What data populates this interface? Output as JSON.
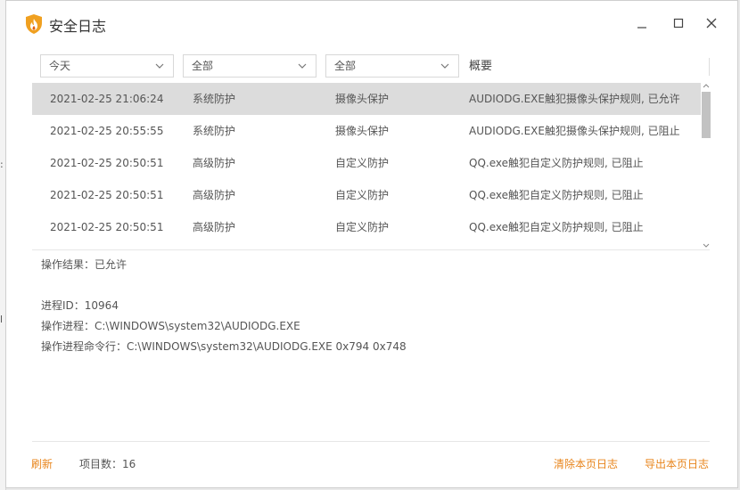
{
  "window": {
    "title": "安全日志"
  },
  "filters": {
    "time": "今天",
    "type": "全部",
    "subtype": "全部",
    "summary_header": "概要"
  },
  "rows": [
    {
      "time": "2021-02-25 21:06:24",
      "category": "系统防护",
      "module": "摄像头保护",
      "summary": "AUDIODG.EXE触犯摄像头保护规则, 已允许"
    },
    {
      "time": "2021-02-25 20:55:55",
      "category": "系统防护",
      "module": "摄像头保护",
      "summary": "AUDIODG.EXE触犯摄像头保护规则, 已阻止"
    },
    {
      "time": "2021-02-25 20:50:51",
      "category": "高级防护",
      "module": "自定义防护",
      "summary": "QQ.exe触犯自定义防护规则, 已阻止"
    },
    {
      "time": "2021-02-25 20:50:51",
      "category": "高级防护",
      "module": "自定义防护",
      "summary": "QQ.exe触犯自定义防护规则, 已阻止"
    },
    {
      "time": "2021-02-25 20:50:51",
      "category": "高级防护",
      "module": "自定义防护",
      "summary": "QQ.exe触犯自定义防护规则, 已阻止"
    }
  ],
  "detail": {
    "result": "操作结果：已允许",
    "pid": "进程ID：10964",
    "process": "操作进程：C:\\WINDOWS\\system32\\AUDIODG.EXE",
    "cmdline": "操作进程命令行：C:\\WINDOWS\\system32\\AUDIODG.EXE 0x794 0x748"
  },
  "footer": {
    "refresh": "刷新",
    "count_label": "项目数：16",
    "clear": "清除本页日志",
    "export": "导出本页日志"
  },
  "colors": {
    "accent": "#e8851c",
    "selected_row": "#dcdcdc"
  },
  "icons": {
    "logo": "shield-flame-icon",
    "minimize": "minimize-icon",
    "maximize": "maximize-icon",
    "close": "close-icon",
    "dropdown": "chevron-down-icon"
  }
}
